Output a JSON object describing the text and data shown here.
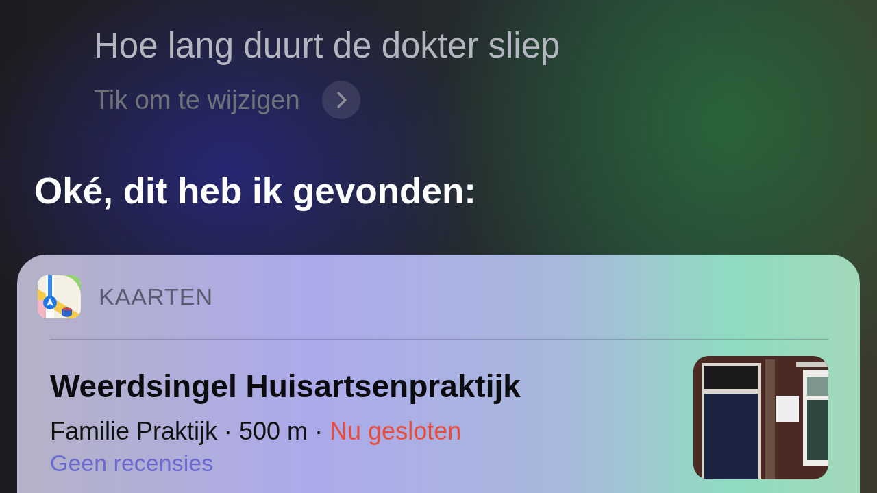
{
  "query": {
    "text": "Hoe lang duurt de dokter sliep",
    "edit_hint": "Tik om te wijzigen"
  },
  "response": "Oké, dit heb ik gevonden:",
  "card": {
    "source": "KAARTEN",
    "result": {
      "name": "Weerdsingel Huisartsenpraktijk",
      "details": "Familie Praktijk · 500 m · ",
      "status": "Nu gesloten",
      "open": false,
      "reviews": "Geen recensies"
    }
  }
}
